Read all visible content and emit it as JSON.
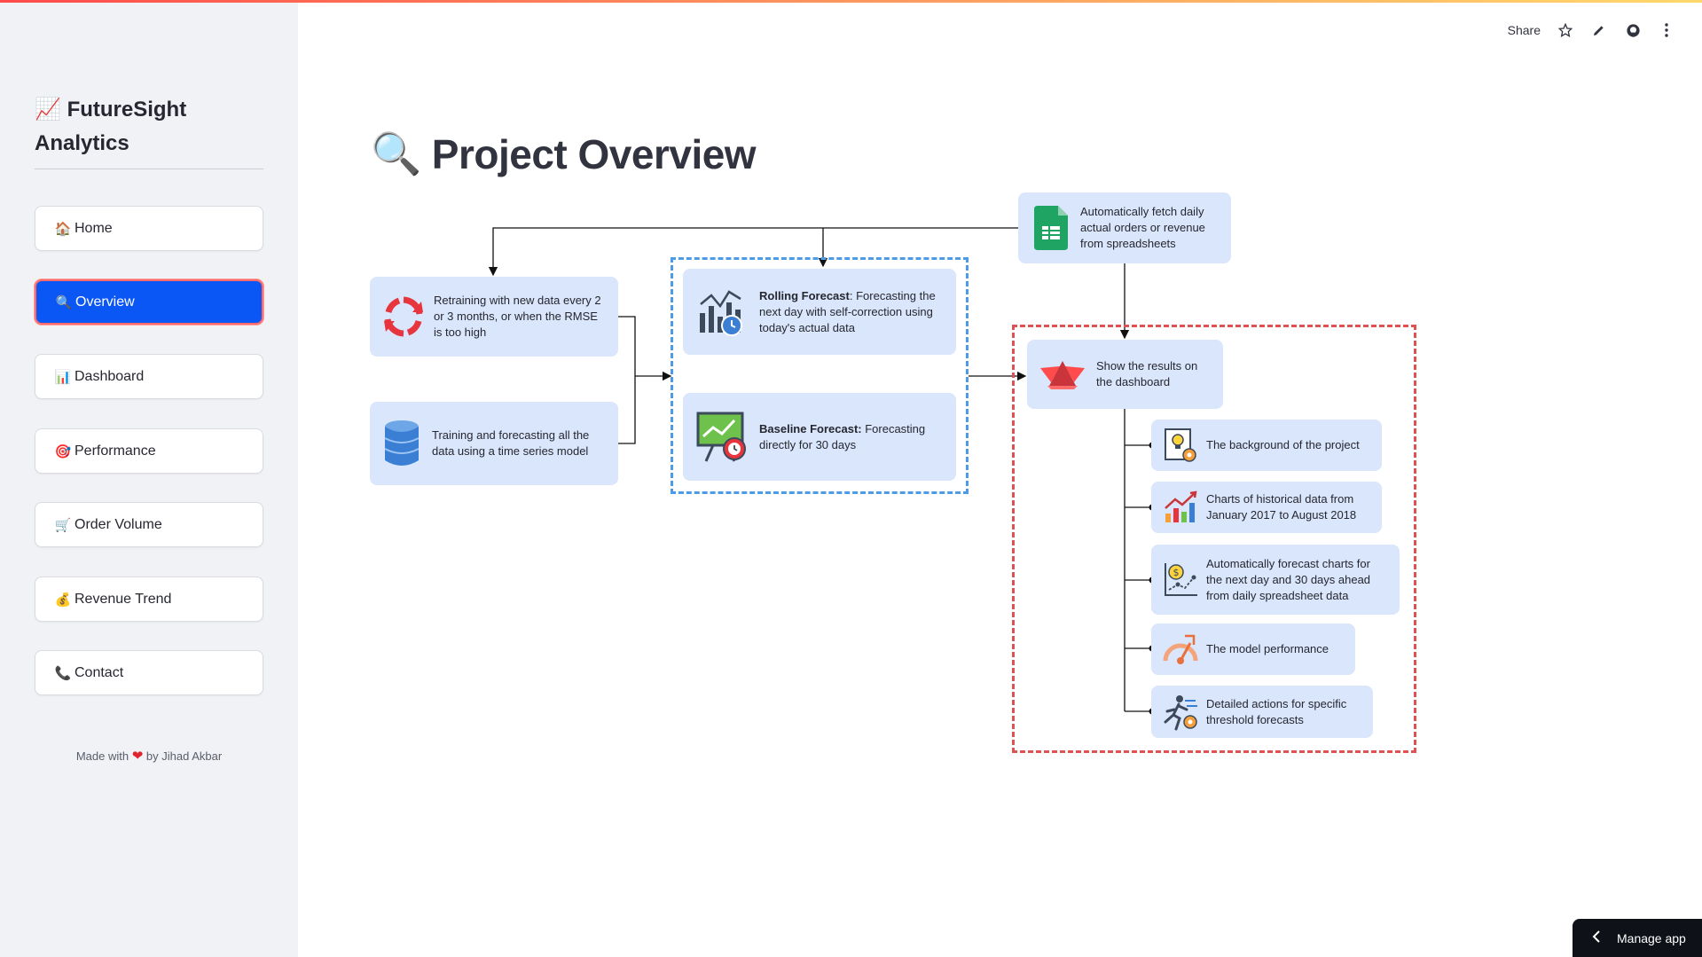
{
  "app": {
    "brand_emoji": "📈",
    "brand": "FutureSight Analytics"
  },
  "header": {
    "share": "Share",
    "icons": [
      "star-icon",
      "pencil-icon",
      "github-icon",
      "more-vertical-icon"
    ]
  },
  "sidebar": {
    "items": [
      {
        "icon": "🏠",
        "label": "Home",
        "active": false
      },
      {
        "icon": "🔍",
        "label": "Overview",
        "active": true
      },
      {
        "icon": "📊",
        "label": "Dashboard",
        "active": false
      },
      {
        "icon": "🎯",
        "label": "Performance",
        "active": false
      },
      {
        "icon": "🛒",
        "label": "Order Volume",
        "active": false
      },
      {
        "icon": "💰",
        "label": "Revenue Trend",
        "active": false
      },
      {
        "icon": "📞",
        "label": "Contact",
        "active": false
      }
    ],
    "footer_pre": "Made with",
    "footer_post": "by Jihad Akbar"
  },
  "page": {
    "title_icon": "🔍",
    "title": "Project Overview"
  },
  "diagram": {
    "fetch": "Automatically fetch daily actual orders or revenue from spreadsheets",
    "retrain": "Retraining with new data every 2 or 3 months, or when the RMSE is too high",
    "train": "Training and forecasting all the data using a time series model",
    "rolling_bold": "Rolling Forecast",
    "rolling_rest": ": Forecasting the next day with self-correction using today's actual data",
    "baseline_bold": "Baseline Forecast:",
    "baseline_rest": " Forecasting directly for 30 days",
    "dashboard": "Show the results on the dashboard",
    "items": [
      "The background of the project",
      "Charts of historical data from January 2017 to August 2018",
      "Automatically forecast charts for the next day and 30 days ahead from daily spreadsheet data",
      "The model performance",
      "Detailed actions for specific threshold forecasts"
    ]
  },
  "manage_app": "Manage app",
  "colors": {
    "accent": "#0b57f5",
    "box": "#d9e6fb",
    "dash_blue": "#4c9be8",
    "dash_red": "#e05252"
  }
}
